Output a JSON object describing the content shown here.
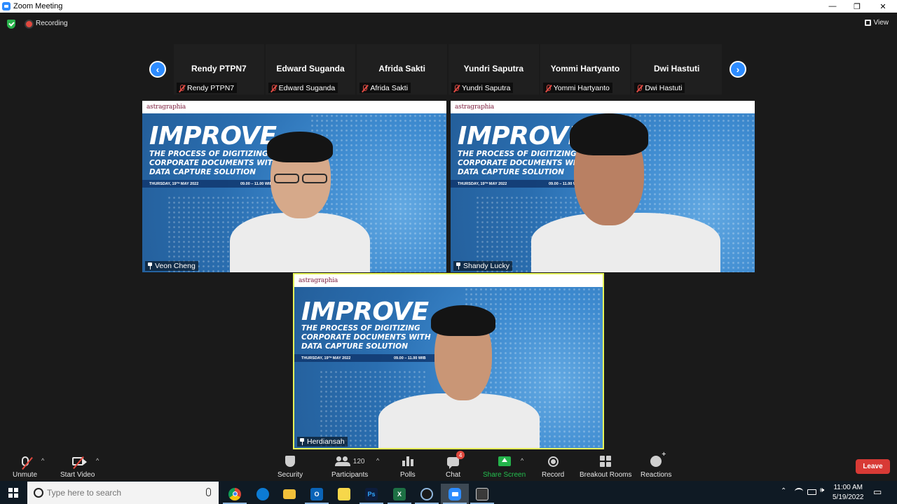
{
  "window": {
    "title": "Zoom Meeting",
    "minimize_glyph": "—",
    "restore_glyph": "❐",
    "close_glyph": "✕"
  },
  "status": {
    "recording_label": "Recording",
    "view_label": "View"
  },
  "strip": {
    "prev_icon": "chevron-left-icon",
    "next_icon": "chevron-right-icon",
    "participants": [
      {
        "display_name": "Rendy PTPN7",
        "label": "Rendy PTPN7",
        "muted": true
      },
      {
        "display_name": "Edward Suganda",
        "label": "Edward Suganda",
        "muted": true
      },
      {
        "display_name": "Afrida Sakti",
        "label": "Afrida Sakti",
        "muted": true
      },
      {
        "display_name": "Yundri Saputra",
        "label": "Yundri Saputra",
        "muted": true
      },
      {
        "display_name": "Yommi Hartyanto",
        "label": "Yommi Hartyanto",
        "muted": true
      },
      {
        "display_name": "Dwi Hastuti",
        "label": "Dwi Hastuti",
        "muted": true
      }
    ]
  },
  "slide": {
    "brand": "astragraphia",
    "headline": "IMPROVE",
    "subtitle_lines": [
      "THE PROCESS OF DIGITIZING",
      "CORPORATE DOCUMENTS WITH",
      "DATA CAPTURE SOLUTION"
    ],
    "date": "THURSDAY, 19ᵀᴴ MAY 2022",
    "time": "09.00 – 11.00 WIB"
  },
  "tiles": [
    {
      "name": "Veon Cheng",
      "pinned": true,
      "active": false
    },
    {
      "name": "Shandy Lucky",
      "pinned": true,
      "active": false
    },
    {
      "name": "Herdiansah",
      "pinned": true,
      "active": true
    }
  ],
  "controls": {
    "unmute": "Unmute",
    "start_video": "Start Video",
    "security": "Security",
    "participants": "Participants",
    "participants_count": "120",
    "polls": "Polls",
    "chat": "Chat",
    "chat_badge": "4",
    "share_screen": "Share Screen",
    "record": "Record",
    "breakout_rooms": "Breakout Rooms",
    "reactions": "Reactions",
    "leave": "Leave",
    "caret": "^"
  },
  "taskbar": {
    "search_placeholder": "Type here to search",
    "apps": [
      {
        "name": "chrome-icon",
        "color": "#db4437"
      },
      {
        "name": "edge-icon",
        "color": "#0c7bd4"
      },
      {
        "name": "file-explorer-icon",
        "color": "#f3c13a"
      },
      {
        "name": "outlook-icon",
        "color": "#0a64b8"
      },
      {
        "name": "sticky-notes-icon",
        "color": "#f7d74a"
      },
      {
        "name": "photoshop-icon",
        "color": "#0d1d3d"
      },
      {
        "name": "excel-icon",
        "color": "#1d7044"
      },
      {
        "name": "obs-icon",
        "color": "#2b4a85"
      },
      {
        "name": "zoom-icon",
        "color": "#2d8cff"
      },
      {
        "name": "terminal-icon",
        "color": "#3a3a3a"
      }
    ],
    "app_glyphs": {
      "outlook": "O",
      "photoshop": "Ps",
      "excel": "X"
    },
    "tray_glyphs": {
      "chevron": "⌃",
      "speaker": "🕪",
      "notifications": "▭"
    },
    "time": "11:00 AM",
    "date": "5/19/2022"
  }
}
